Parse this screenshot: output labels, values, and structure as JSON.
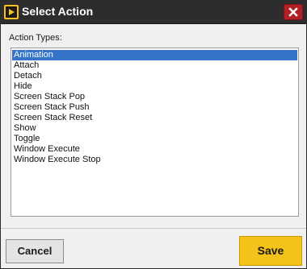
{
  "window": {
    "title": "Select Action",
    "app_icon": "play-icon",
    "close_icon": "close-icon"
  },
  "content": {
    "label": "Action Types:",
    "items": [
      {
        "label": "Animation",
        "selected": true
      },
      {
        "label": "Attach",
        "selected": false
      },
      {
        "label": "Detach",
        "selected": false
      },
      {
        "label": "Hide",
        "selected": false
      },
      {
        "label": "Screen Stack Pop",
        "selected": false
      },
      {
        "label": "Screen Stack Push",
        "selected": false
      },
      {
        "label": "Screen Stack Reset",
        "selected": false
      },
      {
        "label": "Show",
        "selected": false
      },
      {
        "label": "Toggle",
        "selected": false
      },
      {
        "label": "Window Execute",
        "selected": false
      },
      {
        "label": "Window Execute Stop",
        "selected": false
      }
    ]
  },
  "footer": {
    "cancel_label": "Cancel",
    "save_label": "Save"
  },
  "colors": {
    "titlebar": "#2d2d2d",
    "accent_yellow": "#f5c21a",
    "close_red": "#b21f24",
    "selection_blue": "#3574c9"
  }
}
